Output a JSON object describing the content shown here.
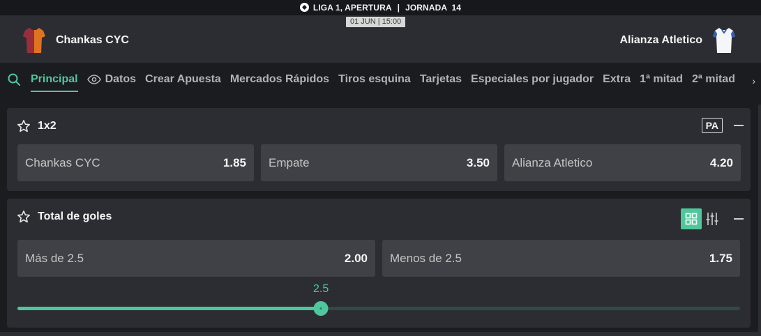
{
  "header": {
    "competition": "LIGA 1, APERTURA",
    "separator": "|",
    "round": "JORNADA  14",
    "datetime": "01 JUN | 15:00",
    "home_team": "Chankas CYC",
    "away_team": "Alianza Atletico",
    "home_shirt_colors": [
      "#e0731f",
      "#9a2d3c"
    ],
    "away_shirt_colors": [
      "#ffffff",
      "#2f5fb3"
    ]
  },
  "tabs": {
    "items": [
      {
        "label": "Principal",
        "active": true
      },
      {
        "label": "Datos",
        "icon": "eye-icon"
      },
      {
        "label": "Crear Apuesta"
      },
      {
        "label": "Mercados Rápidos"
      },
      {
        "label": "Tiros esquina"
      },
      {
        "label": "Tarjetas"
      },
      {
        "label": "Especiales por jugador"
      },
      {
        "label": "Extra"
      },
      {
        "label": "1ª mitad"
      },
      {
        "label": "2ª mitad"
      }
    ],
    "more_icon": "chevron-right-icon"
  },
  "markets": {
    "one_x_two": {
      "title": "1x2",
      "badge": "PA",
      "outcomes": [
        {
          "label": "Chankas CYC",
          "odds": "1.85"
        },
        {
          "label": "Empate",
          "odds": "3.50"
        },
        {
          "label": "Alianza Atletico",
          "odds": "4.20"
        }
      ]
    },
    "total_goals": {
      "title": "Total de goles",
      "outcomes": [
        {
          "label": "Más de 2.5",
          "odds": "2.00"
        },
        {
          "label": "Menos de 2.5",
          "odds": "1.75"
        }
      ],
      "slider": {
        "value": "2.5",
        "fraction": 0.42
      }
    }
  },
  "colors": {
    "accent": "#4fc79c",
    "card": "#2c2d32",
    "odd_button": "#404147",
    "background": "#1b1c20"
  }
}
